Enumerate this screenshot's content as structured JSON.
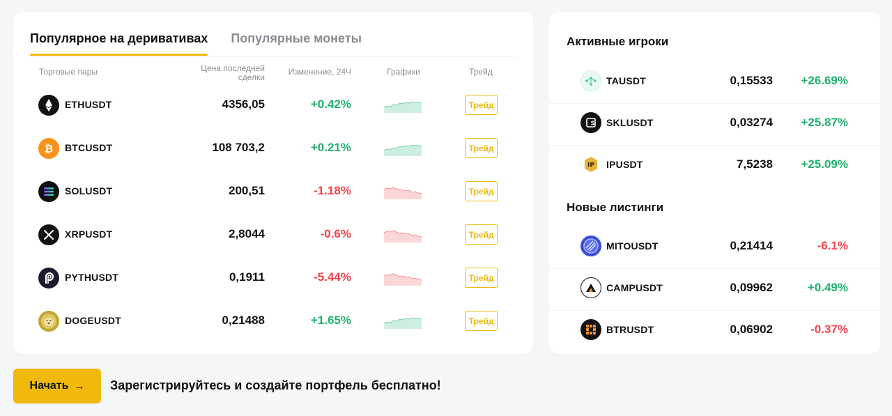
{
  "tabs": {
    "active_label": "Популярное на деривативах",
    "inactive_label": "Популярные монеты"
  },
  "table": {
    "headers": {
      "pair": "Торговые пары",
      "price_line1": "Цена последней",
      "price_line2": "сделки",
      "change": "Изменение, 24Ч",
      "chart": "Графики",
      "trade": "Трейд"
    },
    "rows": [
      {
        "pair": "ETHUSDT",
        "price": "4356,05",
        "change": "+0.42%",
        "trend": "up",
        "trade_label": "Трейд",
        "icon": "ethereum-icon"
      },
      {
        "pair": "BTCUSDT",
        "price": "108 703,2",
        "change": "+0.21%",
        "trend": "up",
        "trade_label": "Трейд",
        "icon": "bitcoin-icon"
      },
      {
        "pair": "SOLUSDT",
        "price": "200,51",
        "change": "-1.18%",
        "trend": "down",
        "trade_label": "Трейд",
        "icon": "solana-icon"
      },
      {
        "pair": "XRPUSDT",
        "price": "2,8044",
        "change": "-0.6%",
        "trend": "down",
        "trade_label": "Трейд",
        "icon": "xrp-icon"
      },
      {
        "pair": "PYTHUSDT",
        "price": "0,1911",
        "change": "-5.44%",
        "trend": "down",
        "trade_label": "Трейд",
        "icon": "pyth-icon"
      },
      {
        "pair": "DOGEUSDT",
        "price": "0,21488",
        "change": "+1.65%",
        "trend": "up",
        "trade_label": "Трейд",
        "icon": "dogecoin-icon"
      }
    ]
  },
  "active_players": {
    "title": "Активные игроки",
    "rows": [
      {
        "pair": "TAUSDT",
        "price": "0,15533",
        "change": "+26.69%",
        "trend": "up",
        "icon": "tao-icon"
      },
      {
        "pair": "SKLUSDT",
        "price": "0,03274",
        "change": "+25.87%",
        "trend": "up",
        "icon": "skale-icon"
      },
      {
        "pair": "IPUSDT",
        "price": "7,5238",
        "change": "+25.09%",
        "trend": "up",
        "icon": "story-ip-icon"
      }
    ]
  },
  "new_listings": {
    "title": "Новые листинги",
    "rows": [
      {
        "pair": "MITOUSDT",
        "price": "0,21414",
        "change": "-6.1%",
        "trend": "down",
        "icon": "mitosis-icon"
      },
      {
        "pair": "CAMPUSDT",
        "price": "0,09962",
        "change": "+0.49%",
        "trend": "up",
        "icon": "camp-icon"
      },
      {
        "pair": "BTRUSDT",
        "price": "0,06902",
        "change": "-0.37%",
        "trend": "down",
        "icon": "bitlayer-icon"
      }
    ]
  },
  "cta": {
    "button_label": "Начать",
    "button_arrow": "→",
    "text": "Зарегистрируйтесь и создайте портфель бесплатно!"
  },
  "colors": {
    "accent": "#f0b90b",
    "positive": "#20b26c",
    "negative": "#ef454a",
    "muted": "#8a8d93"
  }
}
